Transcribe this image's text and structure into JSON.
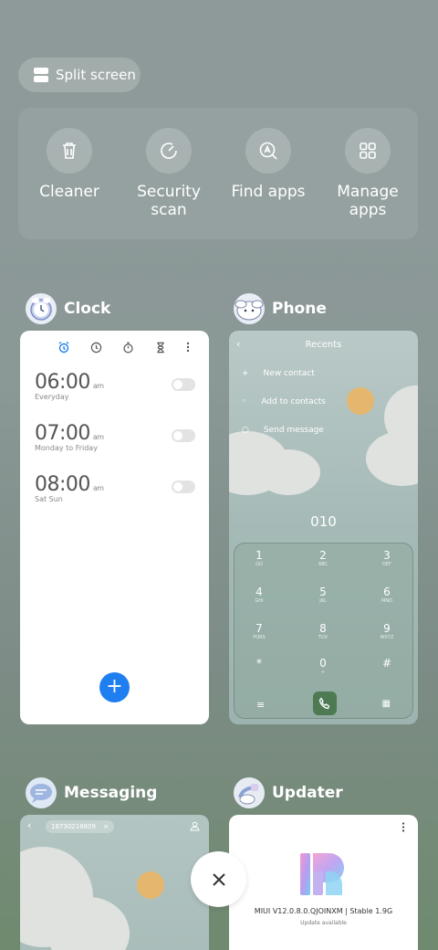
{
  "split_screen": {
    "label": "Split screen"
  },
  "tools": [
    {
      "label": "Cleaner",
      "icon": "trash-icon"
    },
    {
      "label": "Security scan",
      "icon": "security-scan-icon"
    },
    {
      "label": "Find apps",
      "icon": "find-apps-icon"
    },
    {
      "label": "Manage apps",
      "icon": "grid-apps-icon"
    }
  ],
  "apps": {
    "clock": {
      "name": "Clock",
      "alarms": [
        {
          "time": "06:00",
          "ampm": "am",
          "repeat": "Everyday"
        },
        {
          "time": "07:00",
          "ampm": "am",
          "repeat": "Monday to Friday"
        },
        {
          "time": "08:00",
          "ampm": "am",
          "repeat": "Sat Sun"
        }
      ],
      "fab": "+"
    },
    "phone": {
      "name": "Phone",
      "title": "Recents",
      "menu": [
        "New contact",
        "Add to contacts",
        "Send message"
      ],
      "dialed": "010",
      "keys": [
        {
          "n": "1",
          "l": "GO"
        },
        {
          "n": "2",
          "l": "ABC"
        },
        {
          "n": "3",
          "l": "DEF"
        },
        {
          "n": "4",
          "l": "GHI"
        },
        {
          "n": "5",
          "l": "JKL"
        },
        {
          "n": "6",
          "l": "MNO"
        },
        {
          "n": "7",
          "l": "PQRS"
        },
        {
          "n": "8",
          "l": "TUV"
        },
        {
          "n": "9",
          "l": "WXYZ"
        },
        {
          "n": "*",
          "l": ""
        },
        {
          "n": "0",
          "l": "+"
        },
        {
          "n": "#",
          "l": ""
        }
      ]
    },
    "messaging": {
      "name": "Messaging",
      "recipient": "18730218809"
    },
    "updater": {
      "name": "Updater",
      "version": "MIUI V12.0.8.0.QJOINXM | Stable 1.9G",
      "status": "Update available"
    }
  },
  "colors": {
    "accent": "#1f7ff0",
    "sun": "#e5b66d"
  }
}
